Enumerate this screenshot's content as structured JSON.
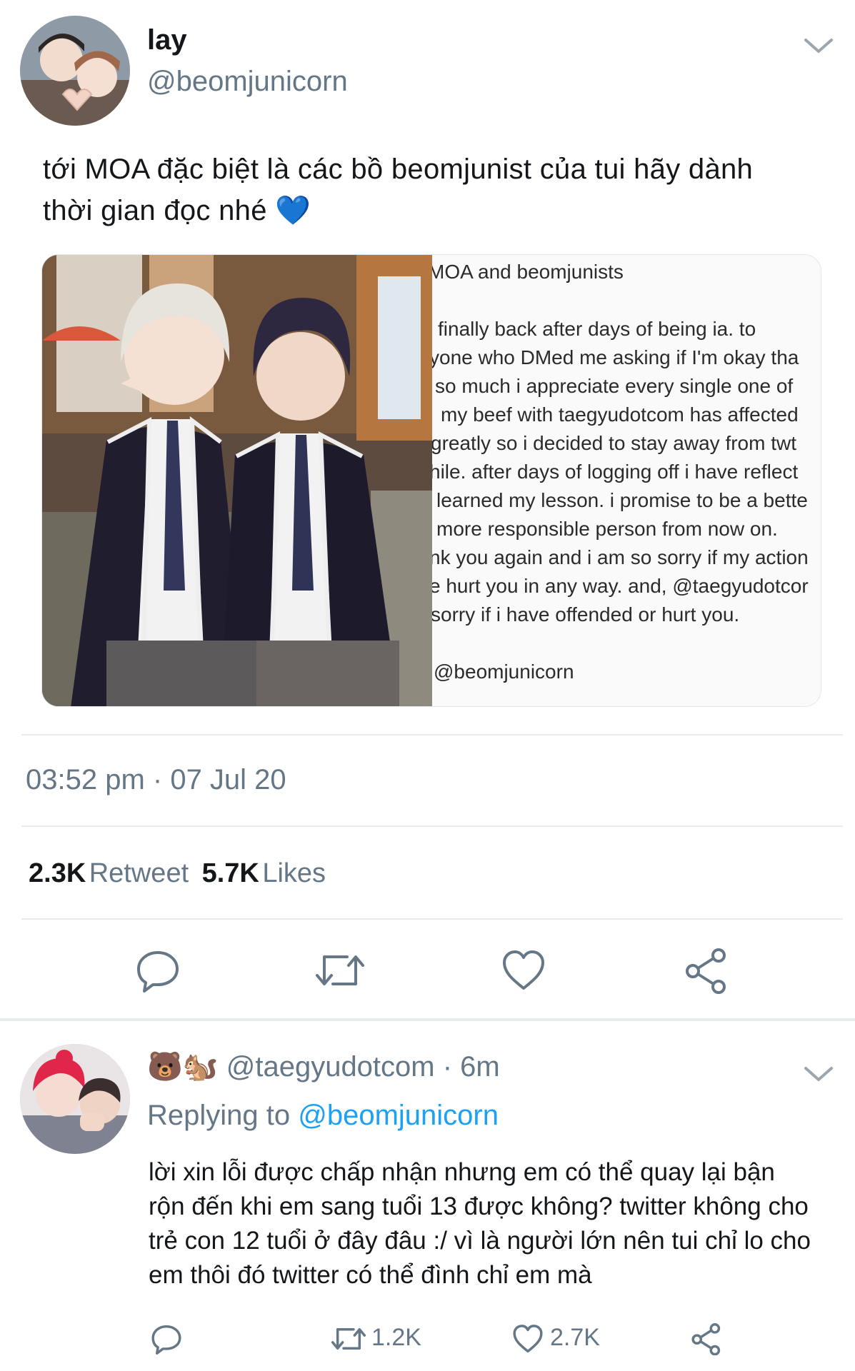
{
  "tweet": {
    "display_name": "lay",
    "handle": "@beomjunicorn",
    "text_lines": [
      "tới MOA đặc biệt là các bồ beomjunist của tui hãy dành",
      "thời gian đọc nhé 💙"
    ],
    "media_note": {
      "lines": [
        "MOA and beomjunists",
        "i finally back after days of being ia. to",
        "yone who DMed me asking if I'm okay tha",
        "so much i appreciate every single one of",
        "my beef with taegyudotcom has affected",
        "greatly so i decided to stay away from twt",
        "hile. after days of logging off i have reflect",
        "learned my lesson. i promise to be a bette",
        "more responsible person from now on.",
        "nk you again and i am so sorry if my action",
        "e hurt you in any way. and, @taegyudotcor",
        "sorry if i have offended or hurt you.",
        "@beomjunicorn"
      ]
    },
    "timestamp": "03:52 pm · 07 Jul 20",
    "retweet_count": "2.3K",
    "retweet_label": "Retweet",
    "like_count": "5.7K",
    "like_label": "Likes"
  },
  "reply": {
    "emoji": "🐻🐿️",
    "handle": "@taegyudotcom",
    "time": "· 6m",
    "replying_prefix": "Replying to",
    "replying_to": "@beomjunicorn",
    "text_lines": [
      "lời xin lỗi được chấp nhận nhưng em có thể quay lại bận",
      "rộn đến khi em sang tuổi 13 được không? twitter không cho",
      "trẻ con 12 tuổi ở đây đâu :/ vì là người lớn nên tui chỉ lo cho",
      "em thôi đó twitter có thể đình chỉ em mà"
    ],
    "retweet_count": "1.2K",
    "like_count": "2.7K"
  },
  "icons": {
    "menu": "chevron-down-icon",
    "reply": "reply-icon",
    "retweet": "retweet-icon",
    "like": "heart-icon",
    "share": "share-icon",
    "heart_emoji": "blue-heart"
  },
  "colors": {
    "text": "#14171a",
    "secondary": "#657786",
    "link": "#1da1f2",
    "divider": "#e6ecf0"
  }
}
